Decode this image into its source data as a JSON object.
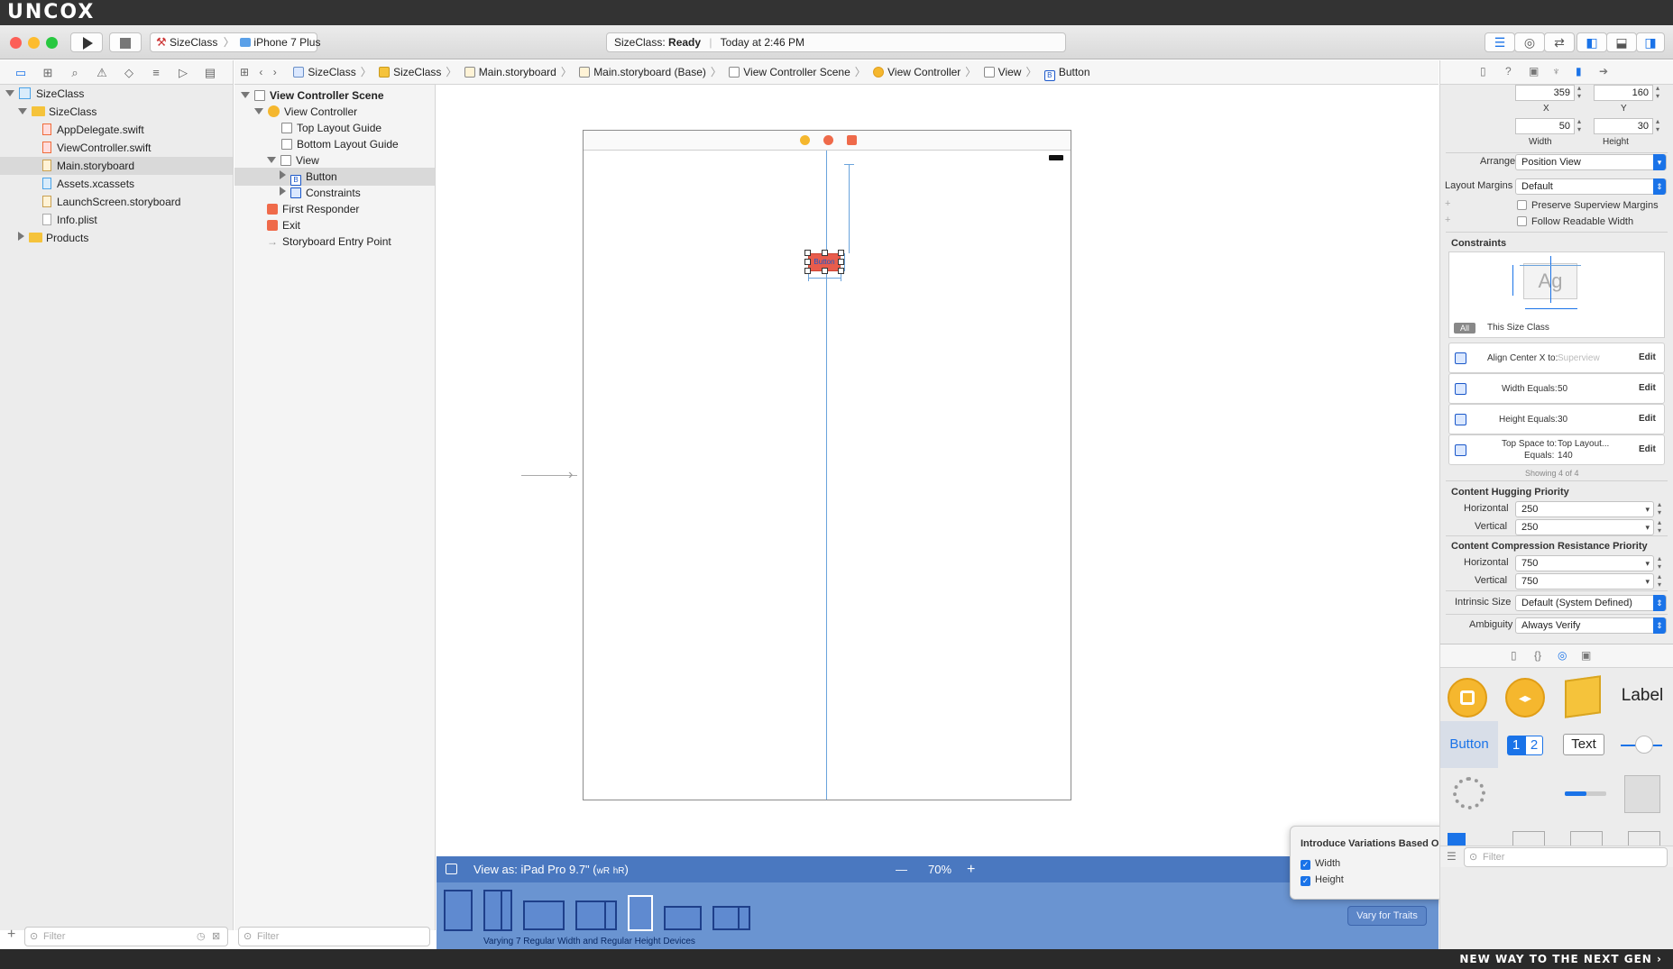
{
  "brand": {
    "logo": "UNCOX",
    "footer": "NEW WAY TO THE NEXT GEN"
  },
  "toolbar": {
    "scheme": "SizeClass",
    "device": "iPhone 7 Plus",
    "status_app": "SizeClass:",
    "status_state": "Ready",
    "status_time": "Today at 2:46 PM"
  },
  "jumpbar": [
    "SizeClass",
    "SizeClass",
    "Main.storyboard",
    "Main.storyboard (Base)",
    "View Controller Scene",
    "View Controller",
    "View",
    "Button"
  ],
  "navigator": {
    "items": [
      {
        "label": "SizeClass"
      },
      {
        "label": "SizeClass"
      },
      {
        "label": "AppDelegate.swift"
      },
      {
        "label": "ViewController.swift"
      },
      {
        "label": "Main.storyboard"
      },
      {
        "label": "Assets.xcassets"
      },
      {
        "label": "LaunchScreen.storyboard"
      },
      {
        "label": "Info.plist"
      },
      {
        "label": "Products"
      }
    ],
    "filter_placeholder": "Filter"
  },
  "outline": {
    "items": [
      {
        "label": "View Controller Scene"
      },
      {
        "label": "View Controller"
      },
      {
        "label": "Top Layout Guide"
      },
      {
        "label": "Bottom Layout Guide"
      },
      {
        "label": "View"
      },
      {
        "label": "Button"
      },
      {
        "label": "Constraints"
      },
      {
        "label": "First Responder"
      },
      {
        "label": "Exit"
      },
      {
        "label": "Storyboard Entry Point"
      }
    ],
    "filter_placeholder": "Filter"
  },
  "canvas": {
    "button_label": "Button"
  },
  "bottombar": {
    "view_as": "View as: iPad Pro 9.7\" (",
    "w_class": "wR",
    "h_class": "hR",
    "view_as_close": ")",
    "zoom_minus": "—",
    "zoom": "70%",
    "zoom_plus": "+",
    "devices_label": "Varying 7 Regular Width and Regular Height Devices",
    "vary_button": "Vary for Traits"
  },
  "popover": {
    "title": "Introduce Variations Based On:",
    "help": "?",
    "width_label": "Width",
    "height_label": "Height"
  },
  "inspector": {
    "x": "359",
    "y": "160",
    "x_label": "X",
    "y_label": "Y",
    "width": "50",
    "height": "30",
    "width_label": "Width",
    "height_label": "Height",
    "arrange_label": "Arrange",
    "arrange_value": "Position View",
    "margins_label": "Layout Margins",
    "margins_value": "Default",
    "preserve_label": "Preserve Superview Margins",
    "readable_label": "Follow Readable Width",
    "constraints_title": "Constraints",
    "ag": "Ag",
    "seg_all": "All",
    "seg_size": "This Size Class",
    "constraints": [
      {
        "label": "Align Center X to:",
        "value": "Superview",
        "edit": "Edit"
      },
      {
        "label": "Width Equals:",
        "value": "50",
        "edit": "Edit"
      },
      {
        "label": "Height Equals:",
        "value": "30",
        "edit": "Edit"
      },
      {
        "label": "Top Space to:",
        "value": "Top Layout...",
        "label2": "Equals:",
        "value2": "140",
        "edit": "Edit"
      }
    ],
    "showing": "Showing 4 of 4",
    "hugging_title": "Content Hugging Priority",
    "horizontal_label": "Horizontal",
    "vertical_label": "Vertical",
    "hug_h": "250",
    "hug_v": "250",
    "compression_title": "Content Compression Resistance Priority",
    "comp_h": "750",
    "comp_v": "750",
    "intrinsic_label": "Intrinsic Size",
    "intrinsic_value": "Default (System Defined)",
    "ambiguity_label": "Ambiguity",
    "ambiguity_value": "Always Verify"
  },
  "library": {
    "label_item": "Label",
    "button_item": "Button",
    "seg1": "1",
    "seg2": "2",
    "text_item": "Text",
    "filter_placeholder": "Filter"
  },
  "colors": {
    "accent": "#1a73e8",
    "selected_button": "#e85c4c",
    "bottom_bar": "#4a78c0",
    "constraint": "#6aa3dc"
  }
}
